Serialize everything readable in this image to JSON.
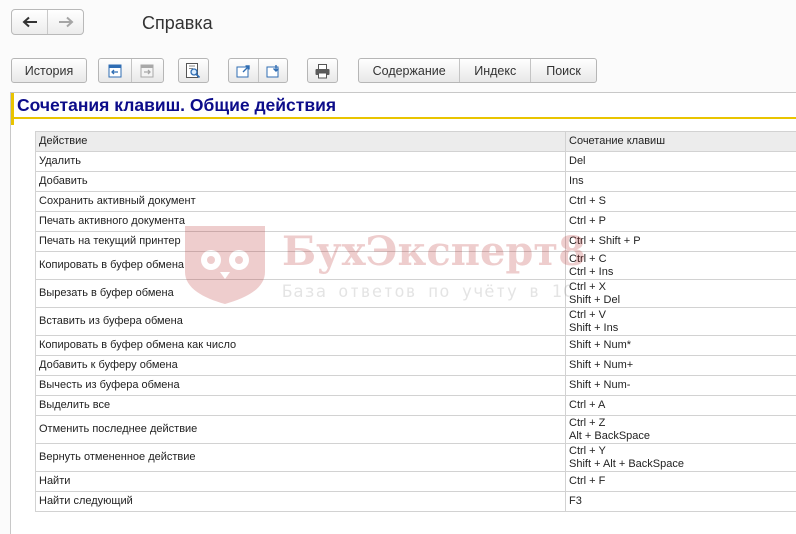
{
  "window": {
    "title": "Справка"
  },
  "nav": {
    "back_icon": "arrow-left-icon",
    "forward_icon": "arrow-right-icon"
  },
  "toolbar": {
    "history_label": "История",
    "contents_label": "Содержание",
    "index_label": "Индекс",
    "search_label": "Поиск"
  },
  "page": {
    "title": "Сочетания клавиш. Общие действия"
  },
  "table": {
    "headers": [
      "Действие",
      "Сочетание клавиш"
    ],
    "rows": [
      {
        "action": "Удалить",
        "keys": "Del"
      },
      {
        "action": "Добавить",
        "keys": "Ins"
      },
      {
        "action": "Сохранить активный документ",
        "keys": "Ctrl + S"
      },
      {
        "action": "Печать активного документа",
        "keys": "Ctrl + P"
      },
      {
        "action": "Печать на текущий принтер",
        "keys": "Ctrl + Shift + P"
      },
      {
        "action": "Копировать в буфер обмена",
        "keys": "Ctrl + C\nCtrl + Ins"
      },
      {
        "action": "Вырезать в буфер обмена",
        "keys": "Ctrl + X\nShift + Del"
      },
      {
        "action": "Вставить из буфера обмена",
        "keys": "Ctrl + V\nShift + Ins"
      },
      {
        "action": "Копировать в буфер обмена как число",
        "keys": "Shift + Num*"
      },
      {
        "action": "Добавить к буферу обмена",
        "keys": "Shift + Num+"
      },
      {
        "action": "Вычесть из буфера обмена",
        "keys": "Shift + Num-"
      },
      {
        "action": "Выделить все",
        "keys": "Ctrl + A"
      },
      {
        "action": "Отменить последнее действие",
        "keys": "Ctrl + Z\nAlt + BackSpace"
      },
      {
        "action": "Вернуть отмененное действие",
        "keys": "Ctrl + Y\nShift + Alt + BackSpace"
      },
      {
        "action": "Найти",
        "keys": "Ctrl + F"
      },
      {
        "action": "Найти следующий",
        "keys": "F3"
      }
    ]
  },
  "watermark": {
    "title": "БухЭксперт8",
    "subtitle": "База ответов по учёту в 1С"
  },
  "colors": {
    "title": "#0c0c8a",
    "accent": "#e9c400",
    "watermark": "#b32020"
  }
}
